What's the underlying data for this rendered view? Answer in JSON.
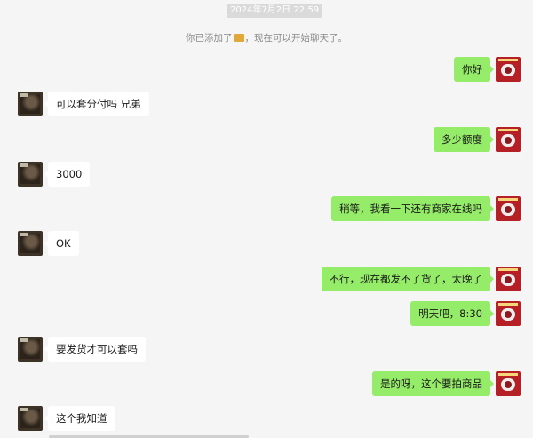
{
  "timestamp": "2024年7月2日 22:59",
  "system_notice": {
    "before": "你已添加了",
    "after": "，现在可以开始聊天了。"
  },
  "messages": [
    {
      "side": "right",
      "text": "你好"
    },
    {
      "side": "left",
      "text": "可以套分付吗 兄弟"
    },
    {
      "side": "right",
      "text": "多少额度"
    },
    {
      "side": "left",
      "text": "3000"
    },
    {
      "side": "right",
      "text": "稍等，我看一下还有商家在线吗"
    },
    {
      "side": "left",
      "text": "OK"
    },
    {
      "side": "right",
      "text": "不行，现在都发不了货了，太晚了"
    },
    {
      "side": "right",
      "text": "明天吧，8:30"
    },
    {
      "side": "left",
      "text": "要发货才可以套吗"
    },
    {
      "side": "right",
      "text": "是的呀，这个要拍商品"
    },
    {
      "side": "left",
      "text": "这个我知道"
    }
  ],
  "colors": {
    "background": "#f5f5f5",
    "outgoing_bubble": "#95ec69",
    "incoming_bubble": "#ffffff"
  }
}
